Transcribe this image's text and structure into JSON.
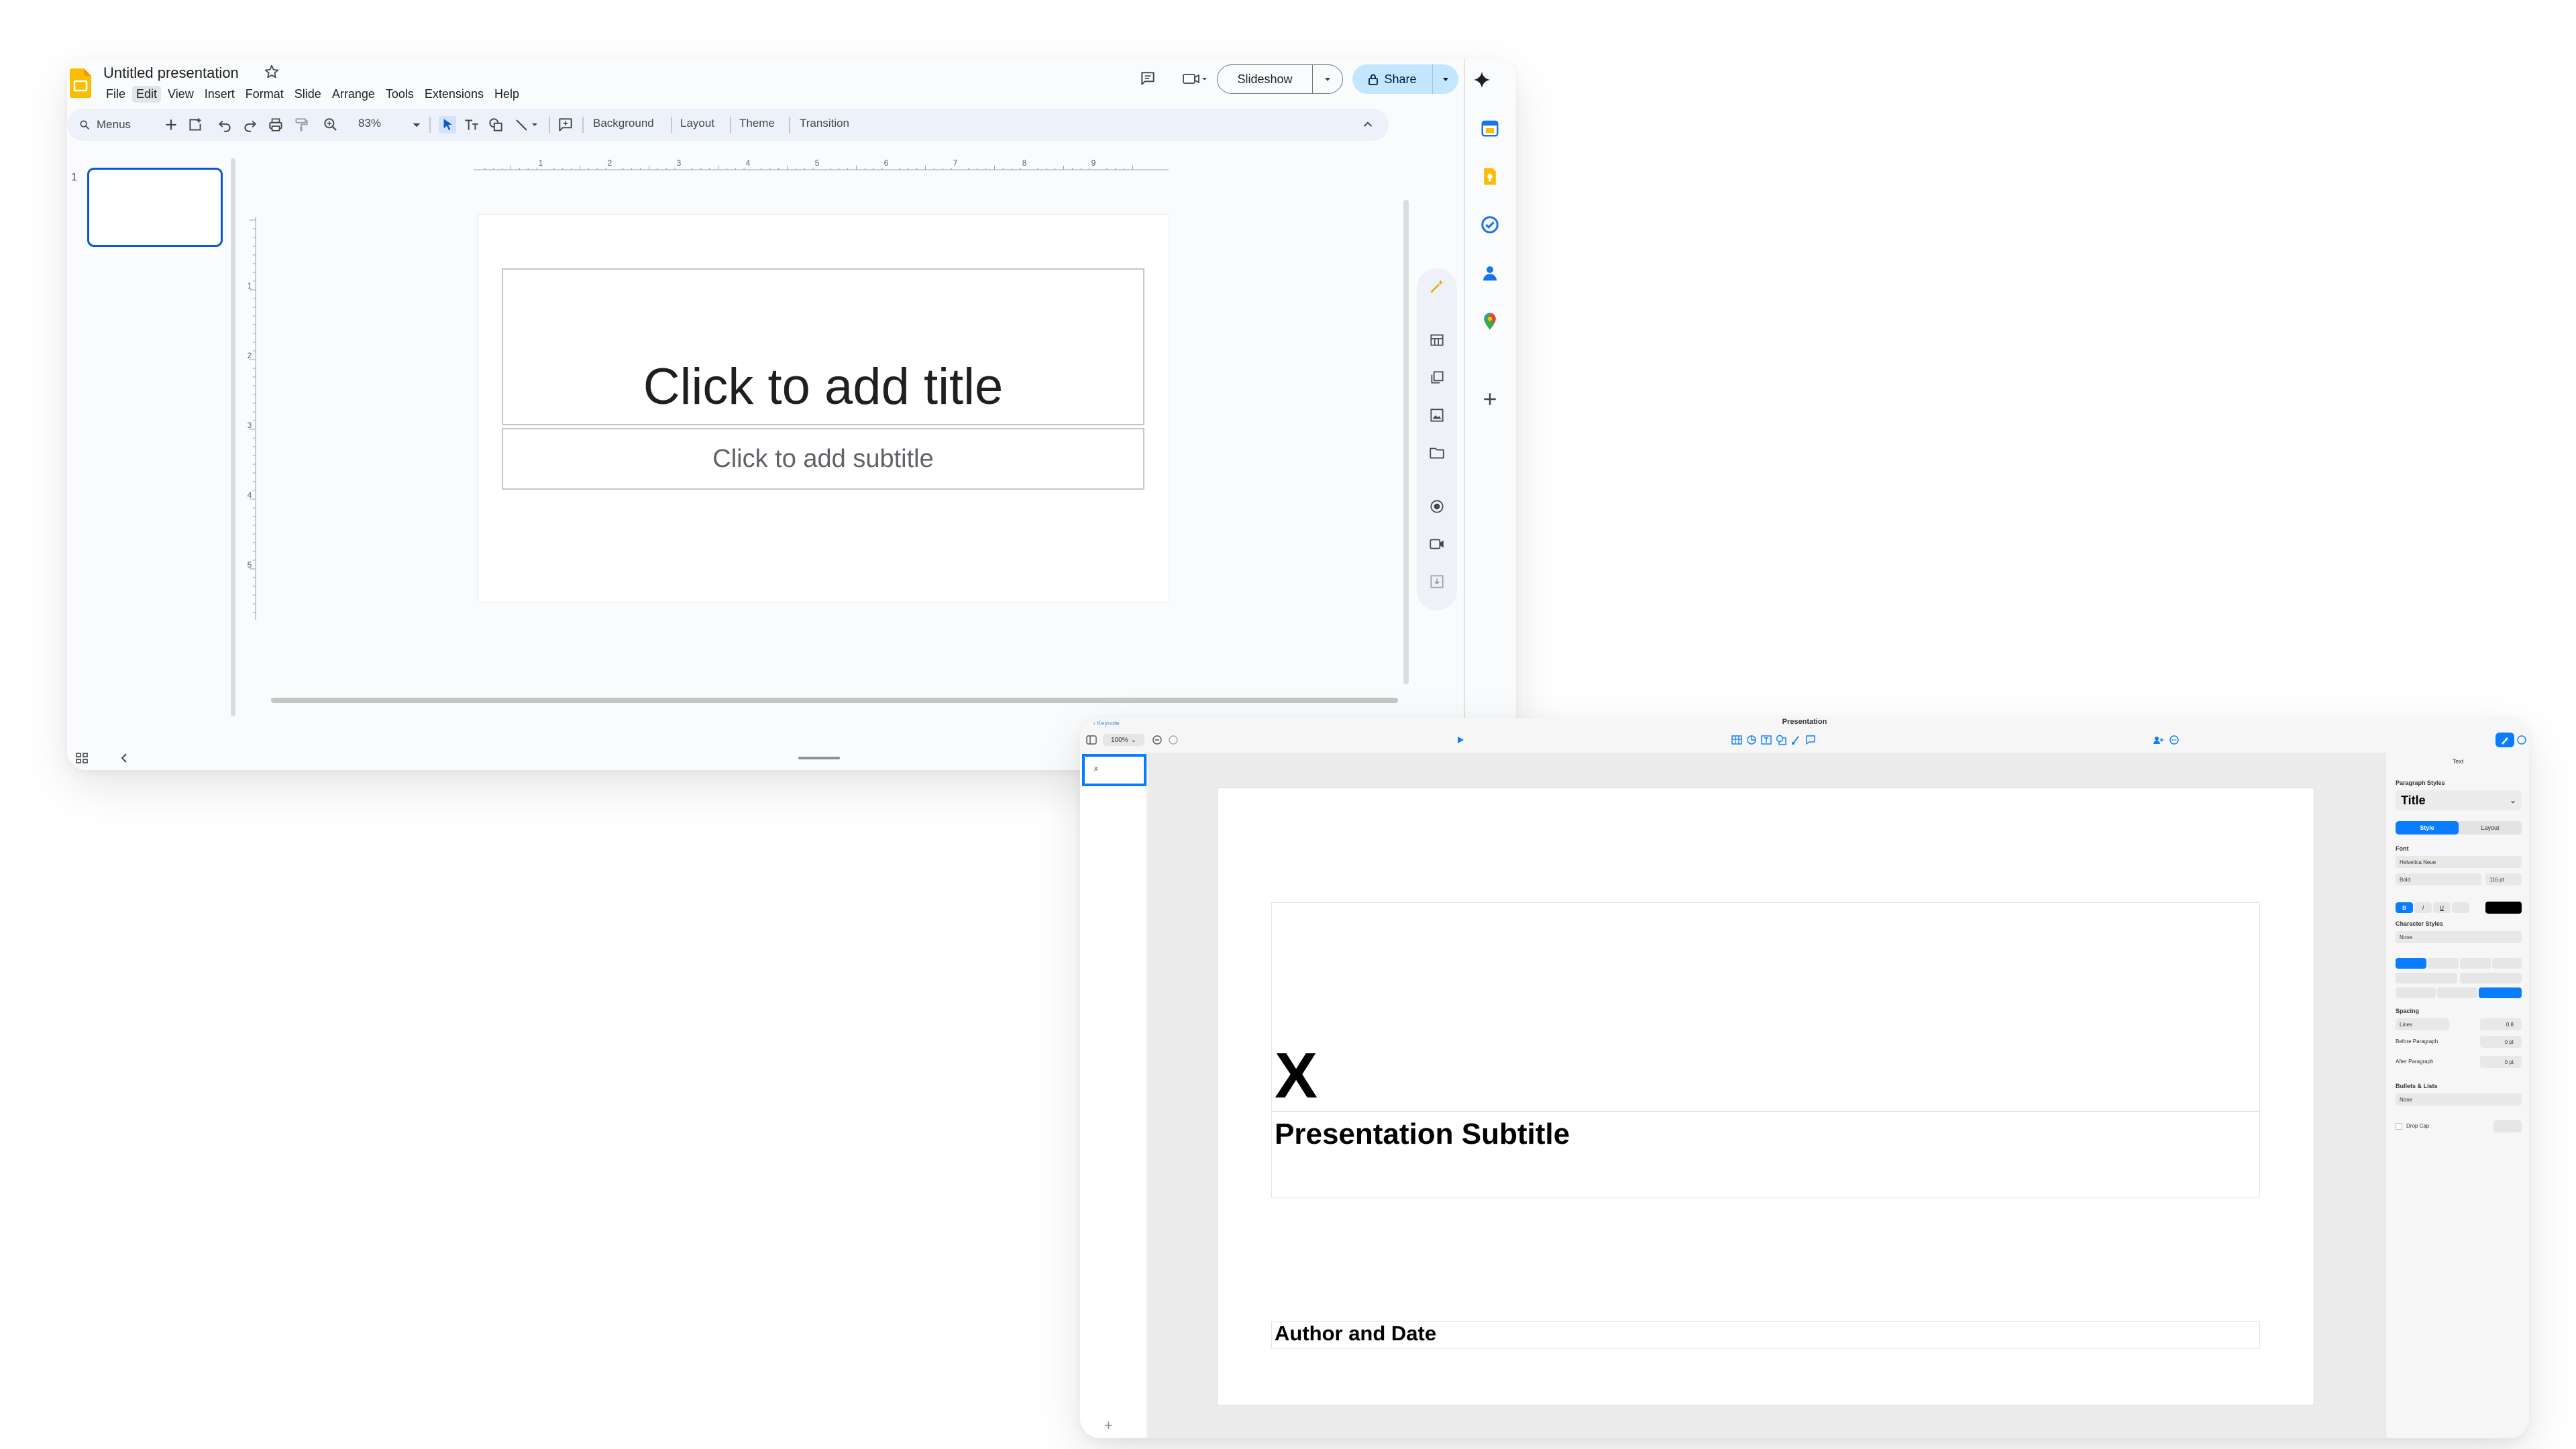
{
  "slides_app": {
    "doc_title": "Untitled presentation",
    "menubar": [
      "File",
      "Edit",
      "View",
      "Insert",
      "Format",
      "Slide",
      "Arrange",
      "Tools",
      "Extensions",
      "Help"
    ],
    "active_menu": "Edit",
    "header": {
      "slideshow_label": "Slideshow",
      "share_label": "Share"
    },
    "toolbar": {
      "search_label": "Menus",
      "zoom": "83%",
      "background_label": "Background",
      "layout_label": "Layout",
      "theme_label": "Theme",
      "transition_label": "Transition"
    },
    "ruler": {
      "h_marks": [
        "1",
        "2",
        "3",
        "4",
        "5",
        "6",
        "7",
        "8",
        "9"
      ],
      "v_marks": [
        "1",
        "2",
        "3",
        "4",
        "5"
      ]
    },
    "filmstrip": {
      "slide_number": "1"
    },
    "slide": {
      "title_placeholder": "Click to add title",
      "subtitle_placeholder": "Click to add subtitle"
    },
    "colors": {
      "accent": "#0b57d0",
      "share_bg": "#c2e7ff",
      "toolbar_bg": "#edf2fa"
    }
  },
  "keynote_app": {
    "breadcrumb": "Keynote",
    "doc_title": "Presentation",
    "zoom": "100%",
    "slide": {
      "title": "X",
      "subtitle": "Presentation Subtitle",
      "author": "Author and Date"
    },
    "inspector": {
      "tab_label": "Text",
      "paragraph_styles_label": "Paragraph Styles",
      "paragraph_style": "Title",
      "seg_style": "Style",
      "seg_layout": "Layout",
      "font_label": "Font",
      "font_family": "Helvetica Neue",
      "font_weight": "Bold",
      "font_size": "116 pt",
      "bold_label": "B",
      "italic_label": "I",
      "underline_label": "U",
      "character_styles_label": "Character Styles",
      "character_style": "None",
      "spacing_label": "Spacing",
      "spacing_mode": "Lines",
      "spacing_value": "0.8",
      "before_paragraph_label": "Before Paragraph",
      "before_paragraph_value": "0 pt",
      "after_paragraph_label": "After Paragraph",
      "after_paragraph_value": "0 pt",
      "bullets_label": "Bullets & Lists",
      "bullets_value": "None",
      "drop_cap_label": "Drop Cap"
    },
    "colors": {
      "accent": "#0a7cff"
    }
  }
}
